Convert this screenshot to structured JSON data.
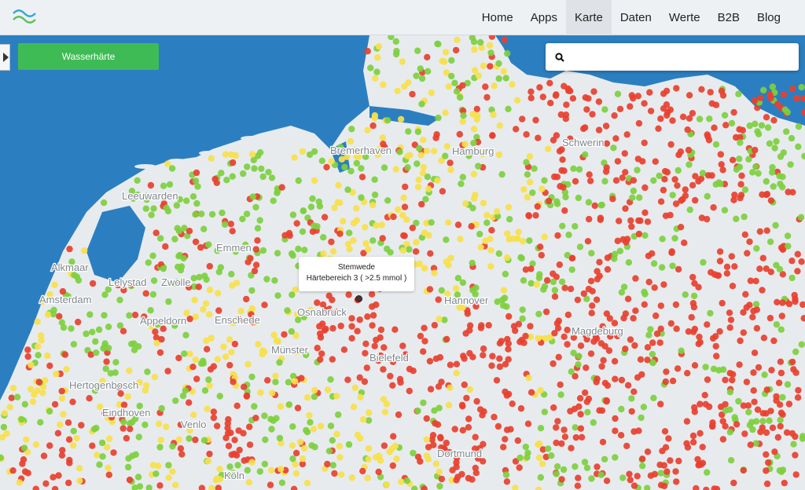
{
  "nav": {
    "items": [
      "Home",
      "Apps",
      "Karte",
      "Daten",
      "Werte",
      "B2B",
      "Blog"
    ],
    "active": "Karte"
  },
  "sidebar": {
    "button_label": "Wasserhärte"
  },
  "search": {
    "placeholder": "",
    "value": ""
  },
  "tooltip": {
    "title": "Stemwede",
    "detail": "Härtebereich 3 ( >2.5 mmol )"
  },
  "map": {
    "cities": [
      "Bremerhaven",
      "Hamburg",
      "Schwerin",
      "Leeuwarden",
      "Alkmaar",
      "Lelystad",
      "Zwolle",
      "Emmen",
      "Amsterdam",
      "Appeldorn",
      "Enschede",
      "Osnabrück",
      "Hannover",
      "Magdeburg",
      "Münster",
      "Bielefeld",
      "Eindhoven",
      "Venlo",
      "Dortmund",
      "Köln",
      "Hertogenbosch"
    ],
    "colors": {
      "soft": "#7ecf3f",
      "medium": "#f7e04c",
      "hard": "#e8402f",
      "water": "#2b7fc1",
      "land": "#e7ebee"
    }
  },
  "icons": {
    "logo": "waves-logo-icon",
    "search": "search-icon",
    "toggle": "triangle-right-icon"
  }
}
